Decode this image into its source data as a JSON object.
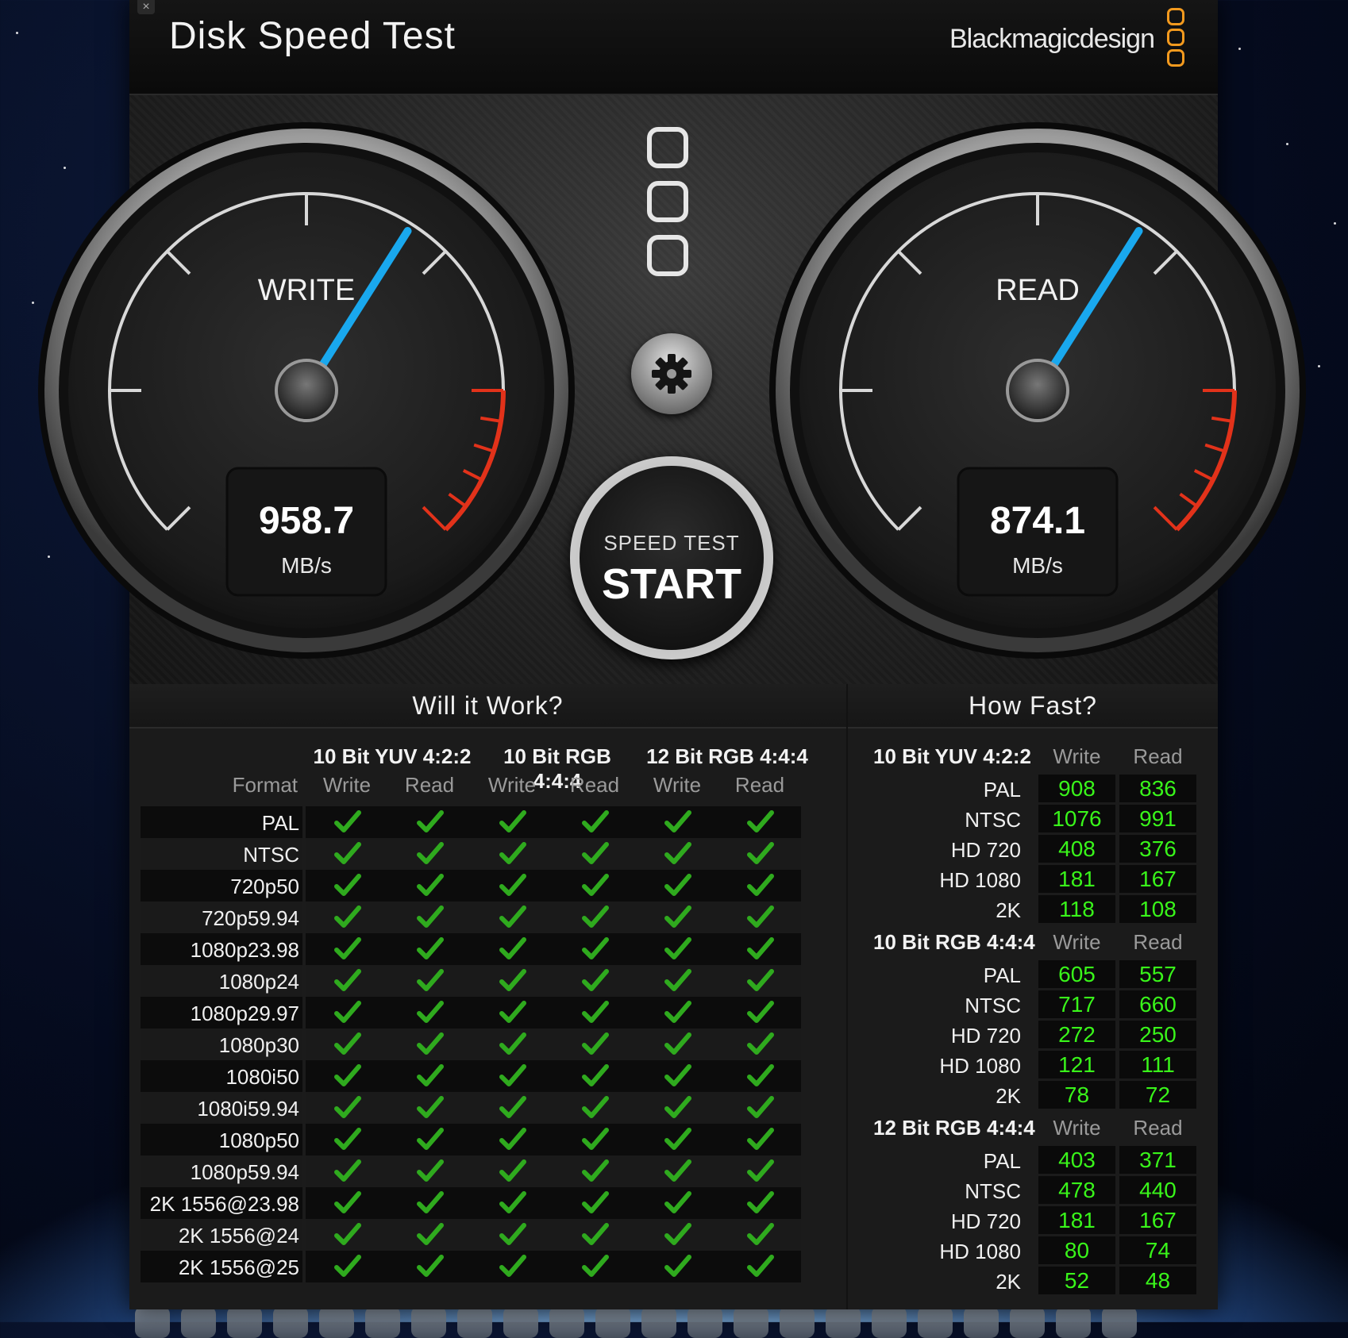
{
  "app": {
    "title": "Disk Speed Test",
    "brand": "Blackmagicdesign",
    "close_glyph": "×"
  },
  "gauges": {
    "write": {
      "label": "WRITE",
      "value": "958.7",
      "unit": "MB/s",
      "needle_fraction": 0.62
    },
    "read": {
      "label": "READ",
      "value": "874.1",
      "unit": "MB/s",
      "needle_fraction": 0.62
    }
  },
  "controls": {
    "settings_icon": "gear-icon",
    "start_sub": "SPEED TEST",
    "start_label": "START"
  },
  "will_it_work": {
    "title": "Will it Work?",
    "format_header": "Format",
    "groups": [
      "10 Bit YUV 4:2:2",
      "10 Bit RGB 4:4:4",
      "12 Bit RGB 4:4:4"
    ],
    "sub_headers": [
      "Write",
      "Read",
      "Write",
      "Read",
      "Write",
      "Read"
    ],
    "formats": [
      "PAL",
      "NTSC",
      "720p50",
      "720p59.94",
      "1080p23.98",
      "1080p24",
      "1080p29.97",
      "1080p30",
      "1080i50",
      "1080i59.94",
      "1080p50",
      "1080p59.94",
      "2K 1556@23.98",
      "2K 1556@24",
      "2K 1556@25"
    ],
    "check_icon": "check-icon",
    "check_color": "#2faa1e"
  },
  "how_fast": {
    "title": "How Fast?",
    "write_header": "Write",
    "read_header": "Read",
    "value_color": "#39f51a",
    "groups": [
      {
        "name": "10 Bit YUV 4:2:2",
        "rows": [
          {
            "label": "PAL",
            "write": "908",
            "read": "836"
          },
          {
            "label": "NTSC",
            "write": "1076",
            "read": "991"
          },
          {
            "label": "HD 720",
            "write": "408",
            "read": "376"
          },
          {
            "label": "HD 1080",
            "write": "181",
            "read": "167"
          },
          {
            "label": "2K",
            "write": "118",
            "read": "108"
          }
        ]
      },
      {
        "name": "10 Bit RGB 4:4:4",
        "rows": [
          {
            "label": "PAL",
            "write": "605",
            "read": "557"
          },
          {
            "label": "NTSC",
            "write": "717",
            "read": "660"
          },
          {
            "label": "HD 720",
            "write": "272",
            "read": "250"
          },
          {
            "label": "HD 1080",
            "write": "121",
            "read": "111"
          },
          {
            "label": "2K",
            "write": "78",
            "read": "72"
          }
        ]
      },
      {
        "name": "12 Bit RGB 4:4:4",
        "rows": [
          {
            "label": "PAL",
            "write": "403",
            "read": "371"
          },
          {
            "label": "NTSC",
            "write": "478",
            "read": "440"
          },
          {
            "label": "HD 720",
            "write": "181",
            "read": "167"
          },
          {
            "label": "HD 1080",
            "write": "80",
            "read": "74"
          },
          {
            "label": "2K",
            "write": "52",
            "read": "48"
          }
        ]
      }
    ]
  },
  "colors": {
    "brand_orange": "#f39a1e",
    "needle_blue": "#19a8ee",
    "redline": "#e2321a"
  }
}
